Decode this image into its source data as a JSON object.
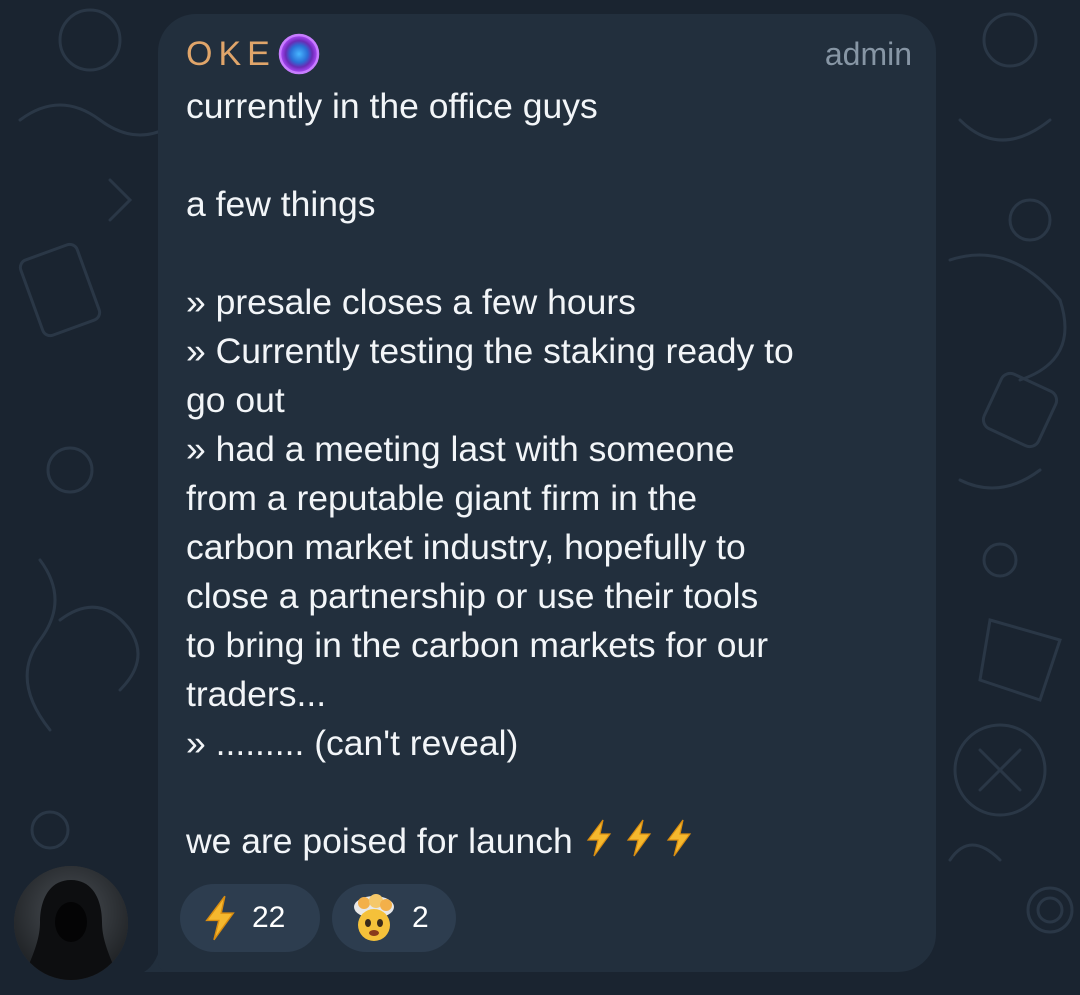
{
  "author": {
    "name": "OKE",
    "role": "admin",
    "badge_icon": "purple-orb-badge"
  },
  "message": {
    "lines": [
      "currently in the office guys",
      "",
      "a few things",
      "",
      "» presale closes a few hours",
      "» Currently testing the staking ready to",
      "go out",
      "» had a meeting last with someone",
      "from a reputable giant firm in the",
      "carbon market industry, hopefully to",
      "close a partnership or use their tools",
      "to bring in the carbon markets for our",
      "traders...",
      "» ......... (can't reveal)",
      "",
      "we are poised for launch"
    ],
    "trailing_emojis": [
      "lightning-bolt",
      "lightning-bolt",
      "lightning-bolt"
    ]
  },
  "reactions": [
    {
      "emoji": "lightning-bolt",
      "count": "22"
    },
    {
      "emoji": "exploding-head",
      "count": "2"
    }
  ],
  "colors": {
    "author_name": "#e0a56a",
    "bubble": "#222f3d",
    "background": "#1a2430",
    "reaction_bg": "#2d3d4f",
    "bolt": "#f5b82e"
  },
  "avatar": {
    "icon": "hooded-figure-avatar"
  }
}
